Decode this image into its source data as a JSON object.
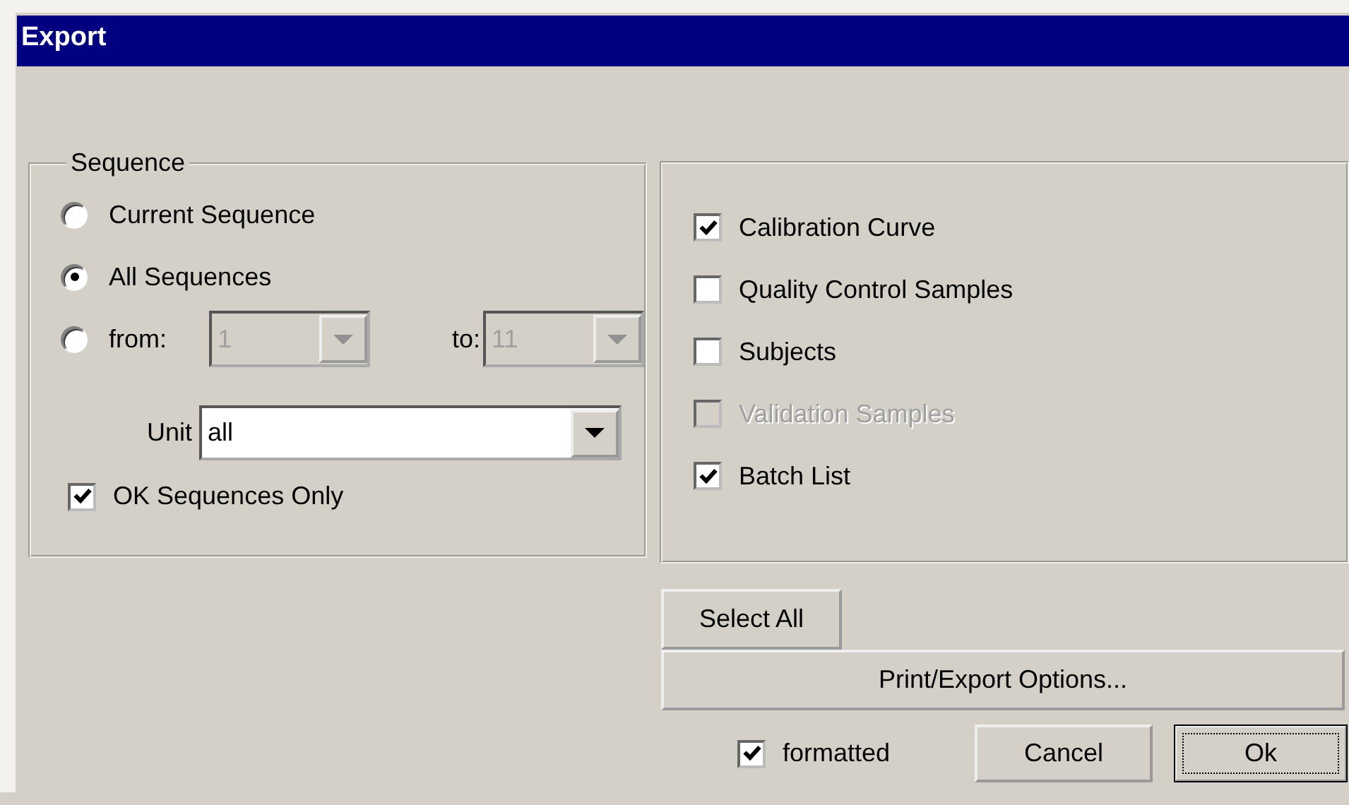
{
  "window": {
    "title": "Export"
  },
  "sequence_group": {
    "title": "Sequence",
    "options": [
      {
        "label": "Current Sequence",
        "selected": false
      },
      {
        "label": "All Sequences",
        "selected": true
      },
      {
        "label": "from:",
        "selected": false
      }
    ],
    "range": {
      "from_value": "1",
      "to_label": "to:",
      "to_value": "11",
      "disabled": true
    },
    "unit": {
      "label": "Unit",
      "value": "all"
    },
    "ok_only": {
      "label": "OK Sequences Only",
      "checked": true
    }
  },
  "items": [
    {
      "label": "Calibration Curve",
      "checked": true,
      "disabled": false
    },
    {
      "label": "Quality Control Samples",
      "checked": false,
      "disabled": false
    },
    {
      "label": "Subjects",
      "checked": false,
      "disabled": false
    },
    {
      "label": "Validation Samples",
      "checked": false,
      "disabled": true
    },
    {
      "label": "Batch List",
      "checked": true,
      "disabled": false
    }
  ],
  "select_all": "Select All",
  "options_button": "Print/Export Options...",
  "formatted": {
    "label": "formatted",
    "checked": true
  },
  "buttons": [
    {
      "label": "Cancel",
      "default": false
    },
    {
      "label": "Ok",
      "default": true
    }
  ]
}
